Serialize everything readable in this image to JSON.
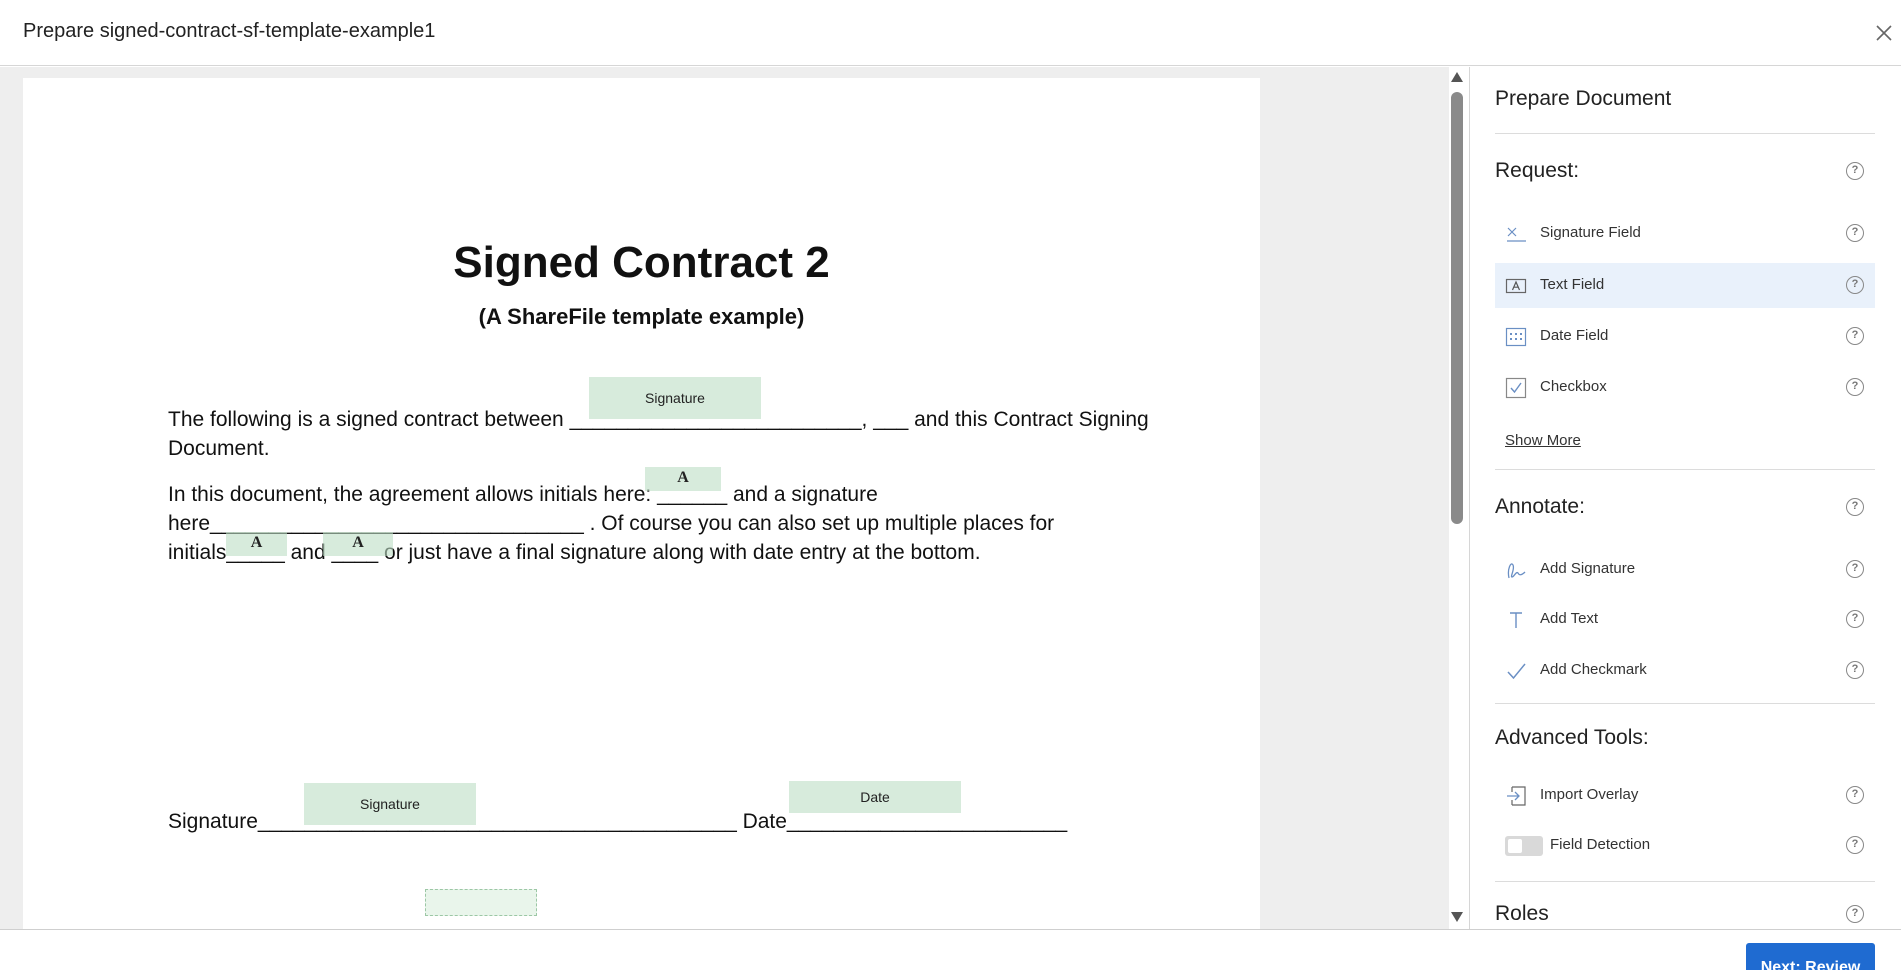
{
  "header": {
    "title": "Prepare signed-contract-sf-template-example1"
  },
  "document": {
    "title": "Signed Contract 2",
    "subtitle": "(A ShareFile template example)",
    "line1": "The following is a signed contract between _________________________, ___ and this Contract Signing",
    "line2": "Document.",
    "line3": "In this document, the agreement allows initials here: ______ and a signature",
    "line4": "here________________________________ . Of course you can also set up multiple places for",
    "line5": "initials_____ and ____ or just have a final signature along with date entry at the bottom.",
    "line6": "Signature_________________________________________ Date________________________",
    "fields": {
      "signature_label": "Signature",
      "date_label": "Date",
      "initial_label": "A"
    }
  },
  "panel": {
    "title": "Prepare Document",
    "request": {
      "heading": "Request:",
      "items": [
        {
          "label": "Signature Field",
          "icon": "signature-field-icon"
        },
        {
          "label": "Text Field",
          "icon": "text-field-icon",
          "active": true
        },
        {
          "label": "Date Field",
          "icon": "calendar-icon"
        },
        {
          "label": "Checkbox",
          "icon": "checkbox-icon"
        }
      ],
      "show_more": "Show More"
    },
    "annotate": {
      "heading": "Annotate:",
      "items": [
        {
          "label": "Add Signature",
          "icon": "pen-signature-icon"
        },
        {
          "label": "Add Text",
          "icon": "text-t-icon"
        },
        {
          "label": "Add Checkmark",
          "icon": "checkmark-icon"
        }
      ]
    },
    "advanced": {
      "heading": "Advanced Tools:",
      "items": [
        {
          "label": "Import Overlay",
          "icon": "import-icon"
        },
        {
          "label": "Field Detection",
          "icon": "toggle-switch",
          "toggle": false
        }
      ]
    },
    "roles": {
      "heading": "Roles"
    },
    "help_glyph": "?"
  },
  "footer": {
    "next_label": "Next: Review"
  },
  "colors": {
    "accent": "#1f6bd1",
    "field_fill": "#d3eadb",
    "active_row": "#e9f1fb",
    "viewer_bg": "#eeeeee"
  }
}
